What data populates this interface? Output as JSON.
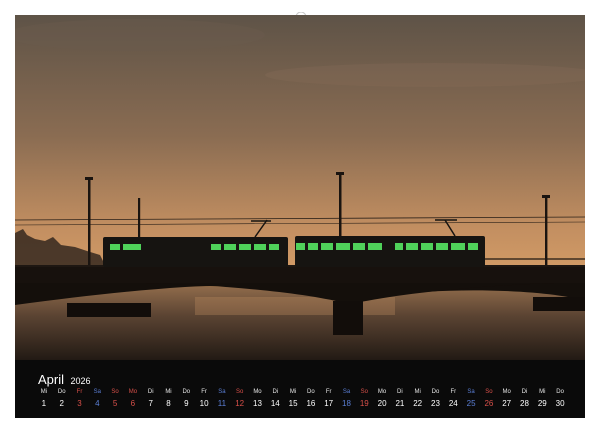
{
  "calendar": {
    "month": "April",
    "year": "2026",
    "days": [
      {
        "wd": "Mi",
        "d": "1",
        "kind": "weekday"
      },
      {
        "wd": "Do",
        "d": "2",
        "kind": "weekday"
      },
      {
        "wd": "Fr",
        "d": "3",
        "kind": "holiday"
      },
      {
        "wd": "Sa",
        "d": "4",
        "kind": "sat"
      },
      {
        "wd": "So",
        "d": "5",
        "kind": "sun"
      },
      {
        "wd": "Mo",
        "d": "6",
        "kind": "holiday"
      },
      {
        "wd": "Di",
        "d": "7",
        "kind": "weekday"
      },
      {
        "wd": "Mi",
        "d": "8",
        "kind": "weekday"
      },
      {
        "wd": "Do",
        "d": "9",
        "kind": "weekday"
      },
      {
        "wd": "Fr",
        "d": "10",
        "kind": "weekday"
      },
      {
        "wd": "Sa",
        "d": "11",
        "kind": "sat"
      },
      {
        "wd": "So",
        "d": "12",
        "kind": "sun"
      },
      {
        "wd": "Mo",
        "d": "13",
        "kind": "weekday"
      },
      {
        "wd": "Di",
        "d": "14",
        "kind": "weekday"
      },
      {
        "wd": "Mi",
        "d": "15",
        "kind": "weekday"
      },
      {
        "wd": "Do",
        "d": "16",
        "kind": "weekday"
      },
      {
        "wd": "Fr",
        "d": "17",
        "kind": "weekday"
      },
      {
        "wd": "Sa",
        "d": "18",
        "kind": "sat"
      },
      {
        "wd": "So",
        "d": "19",
        "kind": "sun"
      },
      {
        "wd": "Mo",
        "d": "20",
        "kind": "weekday"
      },
      {
        "wd": "Di",
        "d": "21",
        "kind": "weekday"
      },
      {
        "wd": "Mi",
        "d": "22",
        "kind": "weekday"
      },
      {
        "wd": "Do",
        "d": "23",
        "kind": "weekday"
      },
      {
        "wd": "Fr",
        "d": "24",
        "kind": "weekday"
      },
      {
        "wd": "Sa",
        "d": "25",
        "kind": "sat"
      },
      {
        "wd": "So",
        "d": "26",
        "kind": "sun"
      },
      {
        "wd": "Mo",
        "d": "27",
        "kind": "weekday"
      },
      {
        "wd": "Di",
        "d": "28",
        "kind": "weekday"
      },
      {
        "wd": "Mi",
        "d": "29",
        "kind": "weekday"
      },
      {
        "wd": "Do",
        "d": "30",
        "kind": "weekday"
      }
    ]
  },
  "colors": {
    "saturday": "#5b7fd6",
    "sunday_holiday": "#d9504a",
    "strip_background": "#0a0a0a",
    "sky_top": "#5e5347",
    "sky_horizon": "#d09a64",
    "tram_windows": "#4fd25a"
  }
}
